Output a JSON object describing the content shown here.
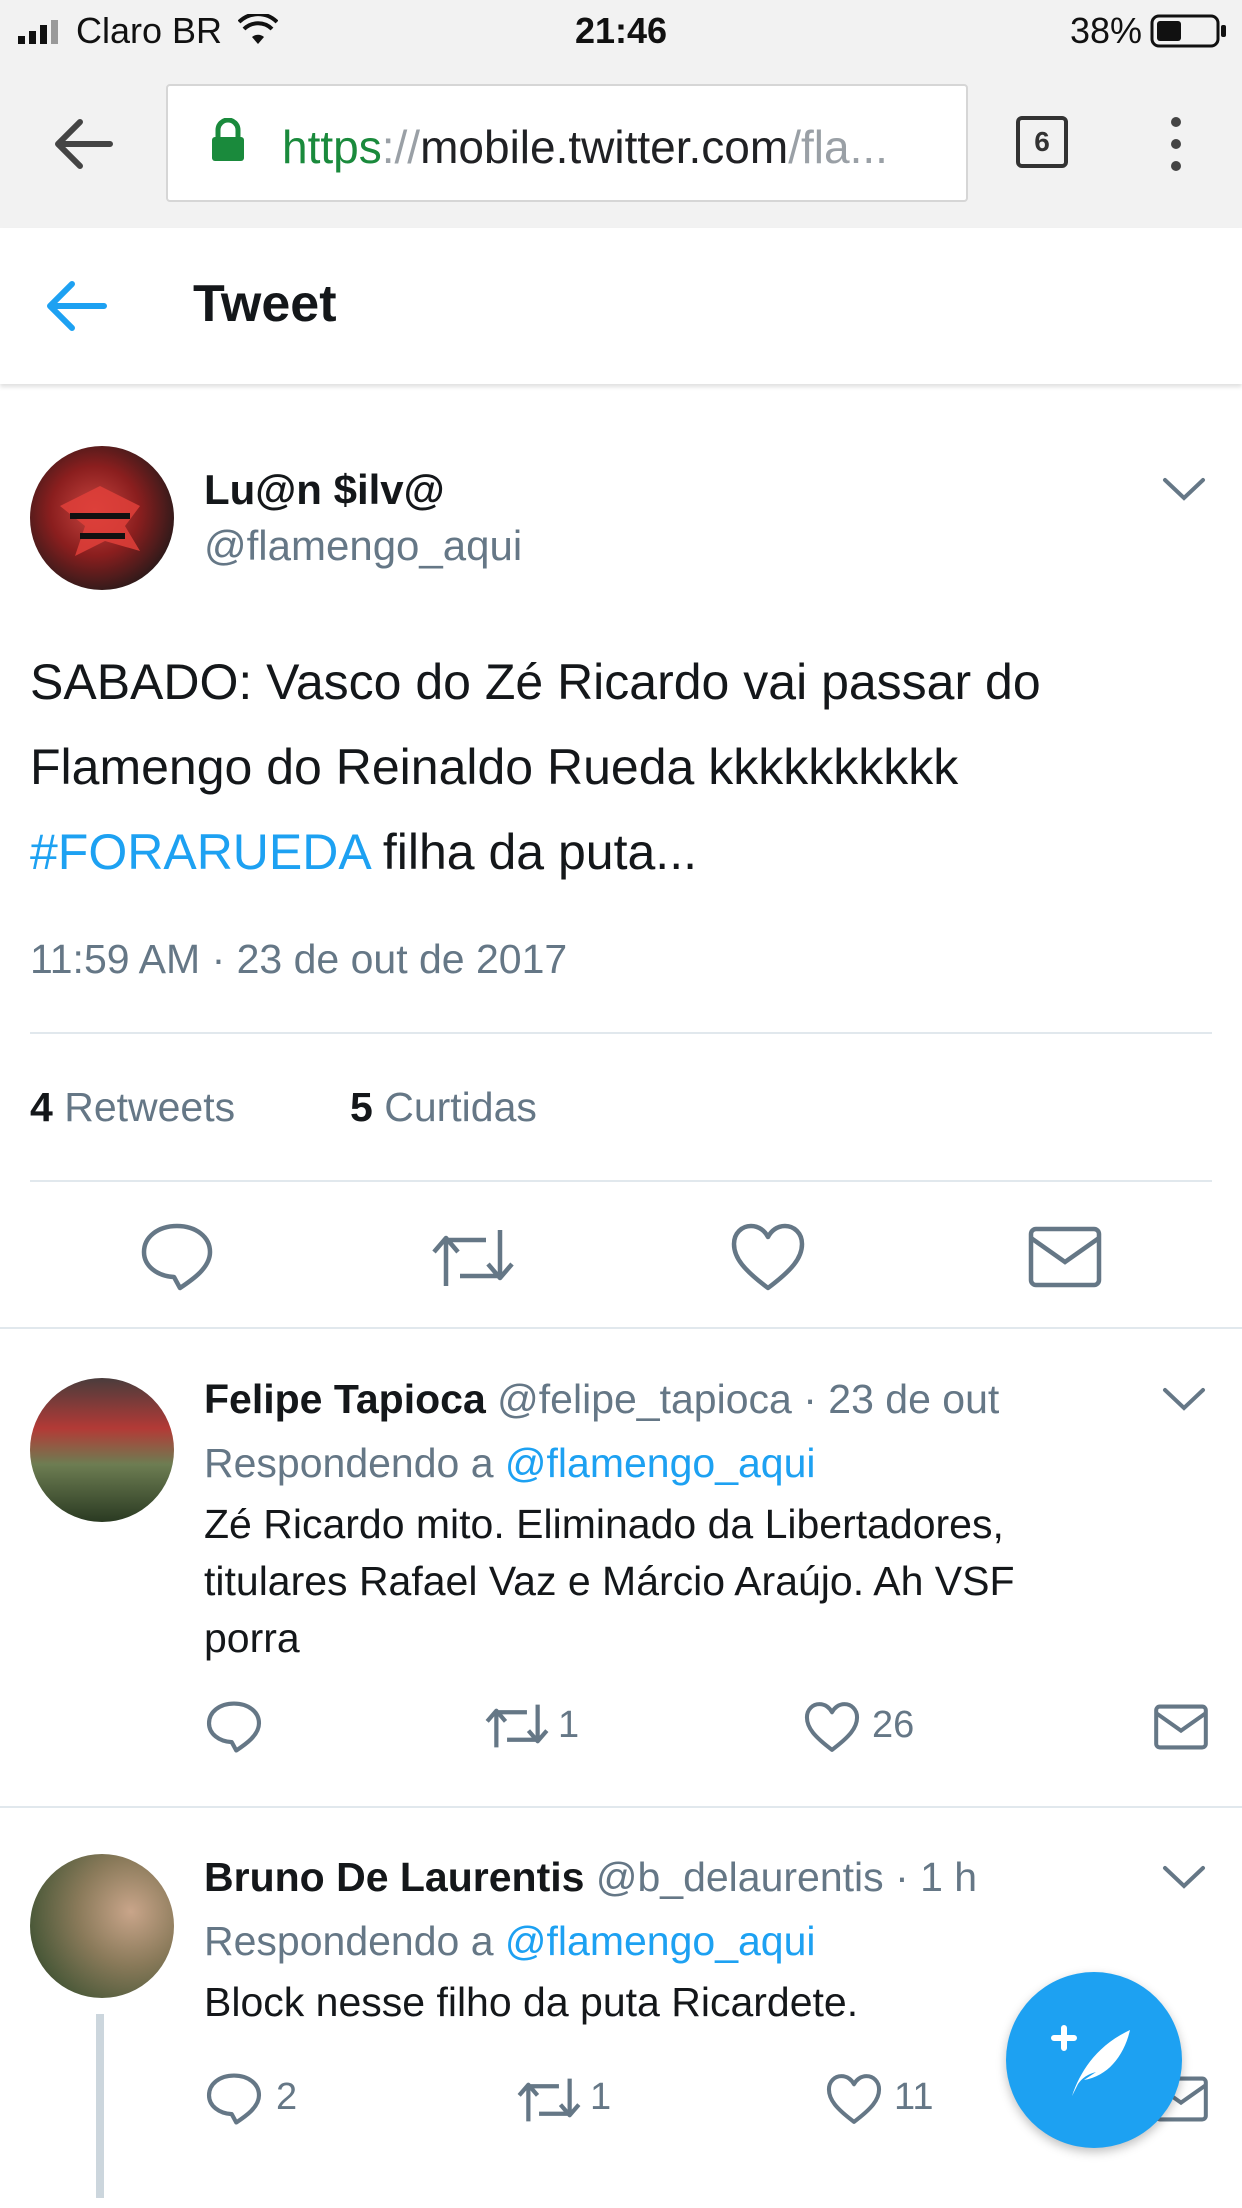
{
  "status_bar": {
    "carrier": "Claro BR",
    "time": "21:46",
    "battery": "38%"
  },
  "browser": {
    "url_scheme": "https",
    "url_sep": "://",
    "url_host": "mobile.twitter.com",
    "url_tail": "/fla...",
    "tab_count": "6"
  },
  "header": {
    "title": "Tweet"
  },
  "main_tweet": {
    "name": "Lu@n $ilv@",
    "handle": "@flamengo_aqui",
    "text_line1": "SABADO: Vasco do Zé Ricardo vai passar do",
    "text_line2": "Flamengo do Reinaldo Rueda kkkkkkkkkk",
    "hashtag": "#FORARUEDA",
    "text_after_hashtag": " filha da puta...",
    "timestamp": "11:59 AM · 23 de out de 2017",
    "retweets_count": "4",
    "retweets_label": "Retweets",
    "likes_count": "5",
    "likes_label": "Curtidas"
  },
  "replies": [
    {
      "name": "Felipe Tapioca",
      "handle": "@felipe_tapioca",
      "time": "· 23 de out",
      "replying_prefix": "Respondendo a ",
      "replying_to": "@flamengo_aqui",
      "text_line1": "Zé Ricardo mito. Eliminado da Libertadores,",
      "text_line2": "titulares Rafael Vaz e Márcio Araújo. Ah VSF",
      "text_line3": "porra",
      "reply_count": "",
      "retweet_count": "1",
      "like_count": "26"
    },
    {
      "name": "Bruno De Laurentis",
      "handle": "@b_delaurentis",
      "time": "· 1 h",
      "replying_prefix": "Respondendo a ",
      "replying_to": "@flamengo_aqui",
      "text_line1": "Block nesse filho da puta Ricardete.",
      "reply_count": "2",
      "retweet_count": "1",
      "like_count": "11"
    }
  ],
  "colors": {
    "accent": "#1da1f2",
    "muted": "#657786",
    "text": "#14171a",
    "secure": "#1a8a3c"
  }
}
